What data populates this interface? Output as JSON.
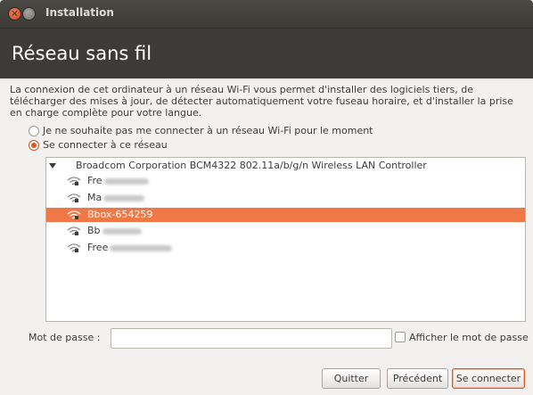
{
  "window": {
    "title": "Installation"
  },
  "header": {
    "title": "Réseau sans fil"
  },
  "intro": "La connexion de cet ordinateur à un réseau Wi-Fi vous permet d'installer des logiciels tiers, de télécharger des mises à jour, de détecter automatiquement votre fuseau horaire, et d'installer la prise en charge complète pour votre langue.",
  "options": [
    {
      "label": "Je ne souhaite pas me connecter à un réseau Wi-Fi pour le moment",
      "checked": false
    },
    {
      "label": "Se connecter à ce réseau",
      "checked": true
    }
  ],
  "network_list": {
    "controller": "Broadcom Corporation BCM4322 802.11a/b/g/n Wireless LAN Controller",
    "networks": [
      {
        "ssid": "Fre",
        "selected": false
      },
      {
        "ssid": "Ma",
        "selected": false
      },
      {
        "ssid": "Bbox-654259",
        "selected": true
      },
      {
        "ssid": "Bb",
        "selected": false
      },
      {
        "ssid": "Free",
        "selected": false
      }
    ]
  },
  "password": {
    "label": "Mot de passe :",
    "value": "",
    "show_label": "Afficher le mot de passe",
    "show_checked": false
  },
  "buttons": {
    "quit": "Quitter",
    "back": "Précédent",
    "connect": "Se connecter"
  },
  "colors": {
    "accent": "#f07746",
    "titlebar": "#3c3b37"
  }
}
